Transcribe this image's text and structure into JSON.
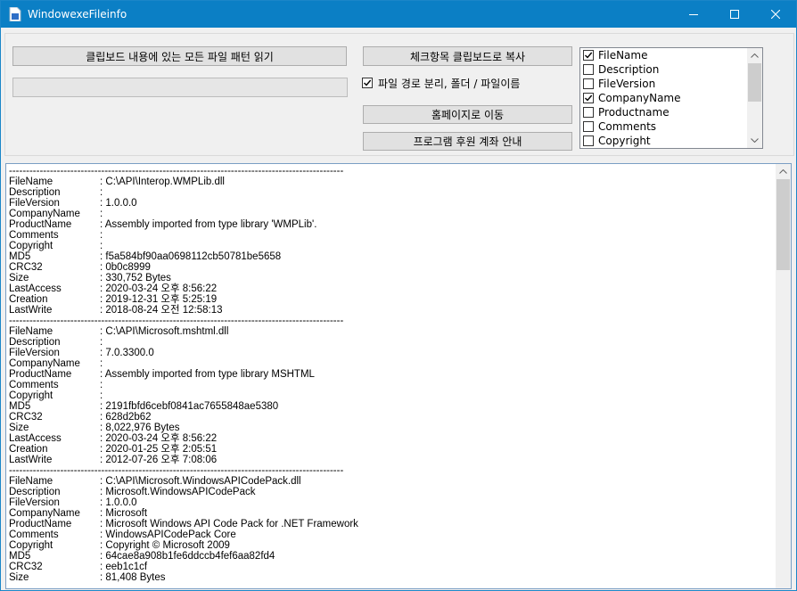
{
  "window": {
    "title": "WindowexeFileinfo"
  },
  "buttons": {
    "read_clipboard": "클립보드 내용에 있는 모든 파일 패턴 읽기",
    "copy_checked": "체크항목 클립보드로 복사",
    "homepage": "홈페이지로 이동",
    "donate": "프로그램 후원 계좌 안내"
  },
  "options": {
    "split_path": {
      "label": "파일 경로 분리, 폴더 / 파일이름",
      "checked": true
    }
  },
  "progress": {
    "value": 0
  },
  "field_list": [
    {
      "label": "FileName",
      "checked": true
    },
    {
      "label": "Description",
      "checked": false
    },
    {
      "label": "FileVersion",
      "checked": false
    },
    {
      "label": "CompanyName",
      "checked": true
    },
    {
      "label": "Productname",
      "checked": false
    },
    {
      "label": "Comments",
      "checked": false
    },
    {
      "label": "Copyright",
      "checked": false
    }
  ],
  "output": {
    "separator": "--------------------------------------------------------------------------------------------------",
    "records": [
      {
        "fields": [
          {
            "key": "FileName",
            "value": ": C:\\API\\Interop.WMPLib.dll"
          },
          {
            "key": "Description",
            "value": ":"
          },
          {
            "key": "FileVersion",
            "value": ": 1.0.0.0"
          },
          {
            "key": "CompanyName",
            "value": ":"
          },
          {
            "key": "ProductName",
            "value": ": Assembly imported from type library 'WMPLib'."
          },
          {
            "key": "Comments",
            "value": ":"
          },
          {
            "key": "Copyright",
            "value": ":"
          },
          {
            "key": "MD5",
            "value": ": f5a584bf90aa0698112cb50781be5658"
          },
          {
            "key": "CRC32",
            "value": ": 0b0c8999"
          },
          {
            "key": "Size",
            "value": ": 330,752 Bytes"
          },
          {
            "key": "LastAccess",
            "value": ": 2020-03-24 오후 8:56:22"
          },
          {
            "key": "Creation",
            "value": ": 2019-12-31 오후 5:25:19"
          },
          {
            "key": "LastWrite",
            "value": ": 2018-08-24 오전 12:58:13"
          }
        ]
      },
      {
        "fields": [
          {
            "key": "FileName",
            "value": ": C:\\API\\Microsoft.mshtml.dll"
          },
          {
            "key": "Description",
            "value": ":"
          },
          {
            "key": "FileVersion",
            "value": ": 7.0.3300.0"
          },
          {
            "key": "CompanyName",
            "value": ":"
          },
          {
            "key": "ProductName",
            "value": ": Assembly imported from type library MSHTML"
          },
          {
            "key": "Comments",
            "value": ":"
          },
          {
            "key": "Copyright",
            "value": ":"
          },
          {
            "key": "MD5",
            "value": ": 2191fbfd6cebf0841ac7655848ae5380"
          },
          {
            "key": "CRC32",
            "value": ": 628d2b62"
          },
          {
            "key": "Size",
            "value": ": 8,022,976 Bytes"
          },
          {
            "key": "LastAccess",
            "value": ": 2020-03-24 오후 8:56:22"
          },
          {
            "key": "Creation",
            "value": ": 2020-01-25 오후 2:05:51"
          },
          {
            "key": "LastWrite",
            "value": ": 2012-07-26 오후 7:08:06"
          }
        ]
      },
      {
        "fields": [
          {
            "key": "FileName",
            "value": ": C:\\API\\Microsoft.WindowsAPICodePack.dll"
          },
          {
            "key": "Description",
            "value": ": Microsoft.WindowsAPICodePack"
          },
          {
            "key": "FileVersion",
            "value": ": 1.0.0.0"
          },
          {
            "key": "CompanyName",
            "value": ": Microsoft"
          },
          {
            "key": "ProductName",
            "value": ": Microsoft Windows API Code Pack for .NET Framework"
          },
          {
            "key": "Comments",
            "value": ": WindowsAPICodePack Core"
          },
          {
            "key": "Copyright",
            "value": ": Copyright © Microsoft 2009"
          },
          {
            "key": "MD5",
            "value": ": 64cae8a908b1fe6ddccb4fef6aa82fd4"
          },
          {
            "key": "CRC32",
            "value": ": eeb1c1cf"
          },
          {
            "key": "Size",
            "value": ": 81,408 Bytes"
          }
        ]
      }
    ]
  }
}
